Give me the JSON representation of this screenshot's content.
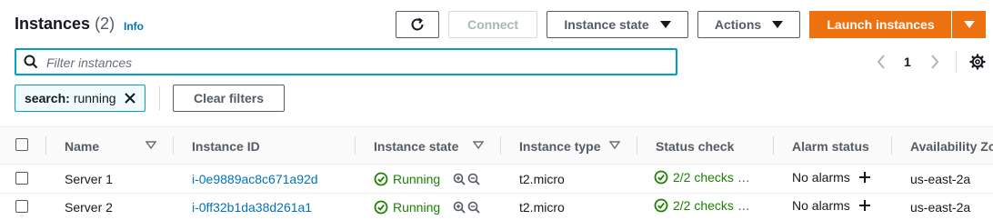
{
  "header": {
    "title": "Instances",
    "count": "(2)",
    "info": "Info"
  },
  "toolbar": {
    "connect_label": "Connect",
    "instance_state_label": "Instance state",
    "actions_label": "Actions",
    "launch_label": "Launch instances"
  },
  "search": {
    "placeholder": "Filter instances",
    "value": ""
  },
  "pagination": {
    "current_page": "1"
  },
  "filters": {
    "token_key": "search:",
    "token_value": "running",
    "clear_label": "Clear filters"
  },
  "table": {
    "columns": [
      "Name",
      "Instance ID",
      "Instance state",
      "Instance type",
      "Status check",
      "Alarm status",
      "Availability Zone"
    ],
    "rows": [
      {
        "name": "Server 1",
        "instance_id": "i-0e9889ac8c671a92d",
        "state": "Running",
        "type": "t2.micro",
        "status_check": "2/2 checks …",
        "alarm": "No alarms",
        "zone": "us-east-2a"
      },
      {
        "name": "Server 2",
        "instance_id": "i-0ff32b1da38d261a1",
        "state": "Running",
        "type": "t2.micro",
        "status_check": "2/2 checks …",
        "alarm": "No alarms",
        "zone": "us-east-2a"
      }
    ]
  },
  "colors": {
    "primary": "#ec7211",
    "link": "#0073bb",
    "success": "#1d8102",
    "focus": "#00a1c9"
  },
  "icons": [
    "refresh-icon",
    "caret-down-icon",
    "search-icon",
    "chevron-left-icon",
    "chevron-right-icon",
    "settings-icon",
    "close-icon",
    "sort-icon",
    "check-circle-icon",
    "zoom-in-icon",
    "zoom-out-icon",
    "plus-icon"
  ]
}
